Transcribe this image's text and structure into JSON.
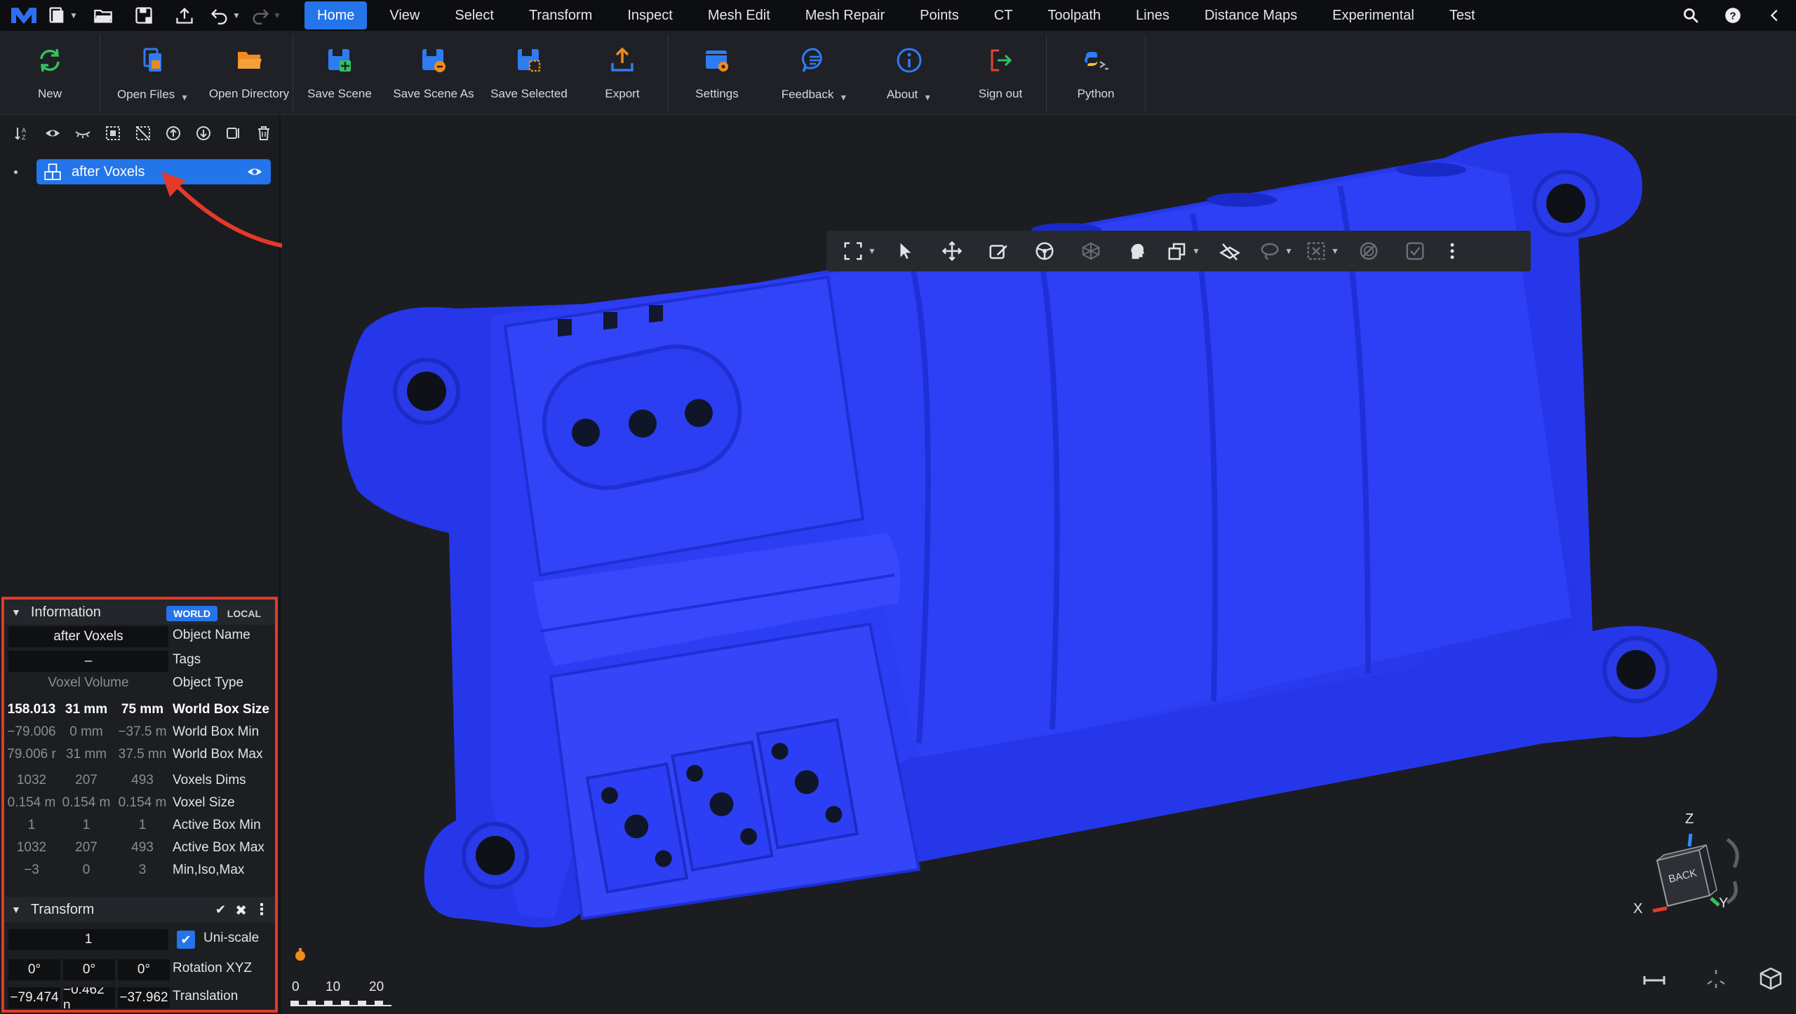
{
  "menubar": {
    "tabs": [
      {
        "label": "Home",
        "active": true
      },
      {
        "label": "View"
      },
      {
        "label": "Select"
      },
      {
        "label": "Transform"
      },
      {
        "label": "Inspect"
      },
      {
        "label": "Mesh Edit"
      },
      {
        "label": "Mesh Repair"
      },
      {
        "label": "Points"
      },
      {
        "label": "CT"
      },
      {
        "label": "Toolpath"
      },
      {
        "label": "Lines"
      },
      {
        "label": "Distance Maps"
      },
      {
        "label": "Experimental"
      },
      {
        "label": "Test"
      }
    ]
  },
  "ribbon": {
    "new": "New",
    "open_files": "Open Files",
    "open_directory": "Open Directory",
    "save_scene": "Save Scene",
    "save_scene_as": "Save Scene As",
    "save_selected": "Save Selected",
    "export": "Export",
    "settings": "Settings",
    "feedback": "Feedback",
    "about": "About",
    "sign_out": "Sign out",
    "python": "Python"
  },
  "scene": {
    "object_name": "after Voxels"
  },
  "info": {
    "title": "Information",
    "world": "WORLD",
    "local": "LOCAL",
    "object_name_value": "after Voxels",
    "object_name_label": "Object Name",
    "tags_value": "–",
    "tags_label": "Tags",
    "object_type_value": "Voxel Volume",
    "object_type_label": "Object Type",
    "world_box_size": [
      "158.013",
      "31 mm",
      "75 mm"
    ],
    "world_box_size_label": "World Box Size",
    "world_box_min": [
      "−79.006",
      "0 mm",
      "−37.5 m"
    ],
    "world_box_min_label": "World Box Min",
    "world_box_max": [
      "79.006 r",
      "31 mm",
      "37.5 mn"
    ],
    "world_box_max_label": "World Box Max",
    "voxels_dims": [
      "1032",
      "207",
      "493"
    ],
    "voxels_dims_label": "Voxels Dims",
    "voxel_size": [
      "0.154 m",
      "0.154 m",
      "0.154 m"
    ],
    "voxel_size_label": "Voxel Size",
    "active_box_min": [
      "1",
      "1",
      "1"
    ],
    "active_box_min_label": "Active Box Min",
    "active_box_max": [
      "1032",
      "207",
      "493"
    ],
    "active_box_max_label": "Active Box Max",
    "min_iso_max": [
      "−3",
      "0",
      "3"
    ],
    "min_iso_max_label": "Min,Iso,Max"
  },
  "transform": {
    "title": "Transform",
    "uniscale_value": "1",
    "uniscale_label": "Uni-scale",
    "rotation": [
      "0°",
      "0°",
      "0°"
    ],
    "rotation_label": "Rotation XYZ",
    "translation": [
      "−79.474",
      "−0.462 n",
      "−37.962"
    ],
    "translation_label": "Translation"
  },
  "viewcube": {
    "face": "BACK",
    "axis_z": "Z",
    "axis_x": "X",
    "axis_y": "Y"
  },
  "scale_bar": {
    "ticks": [
      "0",
      "10",
      "20"
    ]
  },
  "colors": {
    "accent": "#2474ea",
    "mesh": "#2a3cf0",
    "highlight": "#e43a28"
  }
}
